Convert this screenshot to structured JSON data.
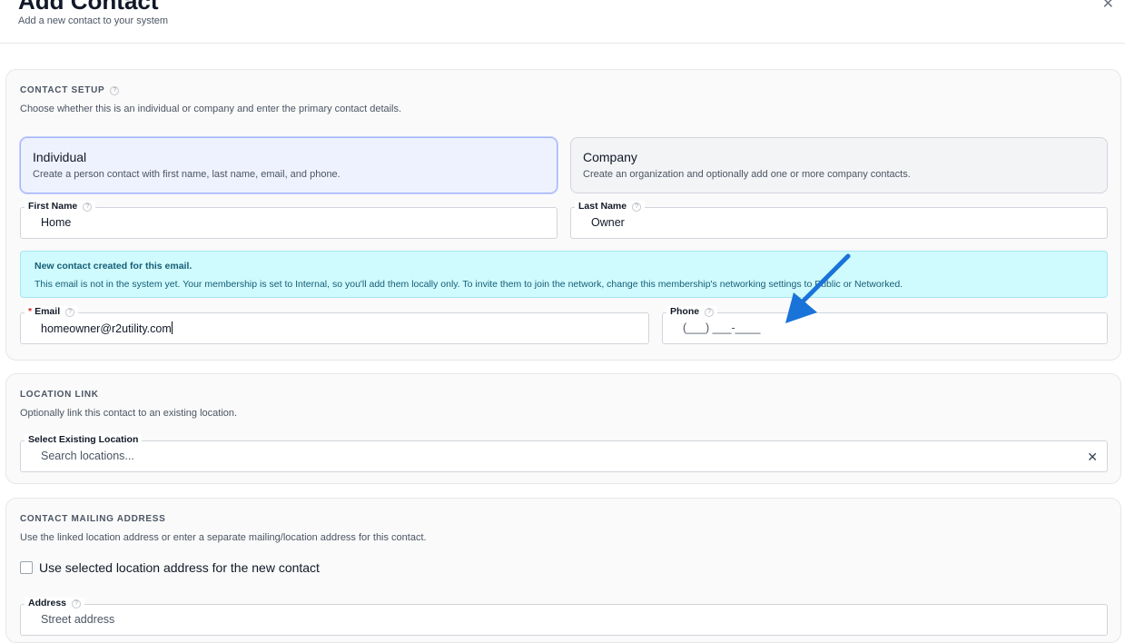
{
  "header": {
    "title": "Add Contact",
    "subtitle": "Add a new contact to your system",
    "close_icon": "close-icon"
  },
  "contact_setup": {
    "title": "CONTACT SETUP",
    "description": "Choose whether this is an individual or company and enter the primary contact details.",
    "types": [
      {
        "title": "Individual",
        "description": "Create a person contact with first name, last name, email, and phone.",
        "selected": true
      },
      {
        "title": "Company",
        "description": "Create an organization and optionally add one or more company contacts.",
        "selected": false
      }
    ],
    "first_name": {
      "label": "First Name",
      "value": "Home"
    },
    "last_name": {
      "label": "Last Name",
      "value": "Owner"
    },
    "info": {
      "title": "New contact created for this email.",
      "text": "This email is not in the system yet. Your membership is set to Internal, so you'll add them locally only. To invite them to join the network, change this membership's networking settings to Public or Networked."
    },
    "email": {
      "label": "Email",
      "required_mark": "*",
      "value": "homeowner@r2utility.com"
    },
    "phone": {
      "label": "Phone",
      "placeholder": "(___) ___-____"
    }
  },
  "location_link": {
    "title": "LOCATION LINK",
    "description": "Optionally link this contact to an existing location.",
    "select": {
      "label": "Select Existing Location",
      "placeholder": "Search locations..."
    }
  },
  "mailing_address": {
    "title": "CONTACT MAILING ADDRESS",
    "description": "Use the linked location address or enter a separate mailing/location address for this contact.",
    "checkbox_label": "Use selected location address for the new contact",
    "checked": false,
    "address": {
      "label": "Address",
      "placeholder": "Street address"
    }
  },
  "annotation": {
    "arrow_color": "#1a73d9"
  },
  "help_glyph": "?",
  "clear_glyph": "✕"
}
